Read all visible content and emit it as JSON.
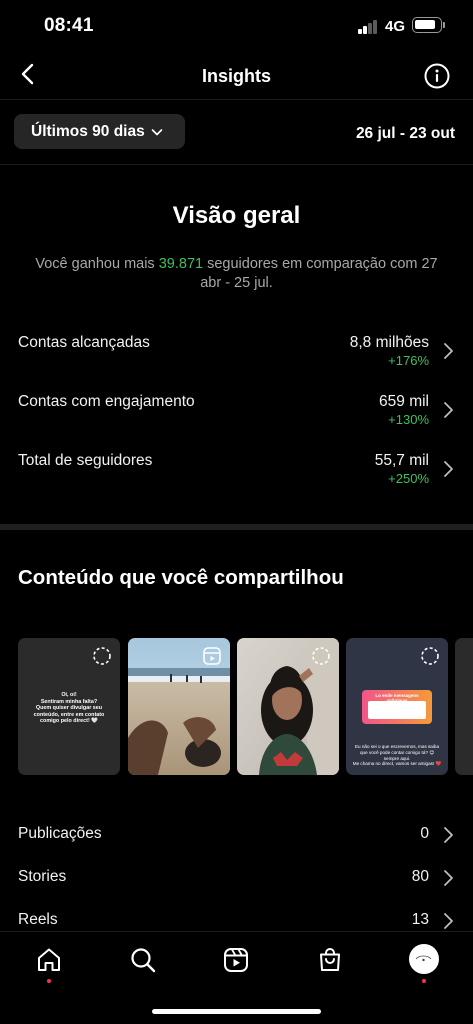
{
  "status_bar": {
    "time": "08:41",
    "network": "4G"
  },
  "nav": {
    "title": "Insights"
  },
  "filter": {
    "range_label": "Últimos 90 dias",
    "date_range": "26 jul - 23 out"
  },
  "overview": {
    "title": "Visão geral",
    "summary_prefix": "Você ganhou mais ",
    "summary_highlight": "39.871",
    "summary_suffix": " seguidores em comparação com 27 abr - 25 jul."
  },
  "metrics": [
    {
      "label": "Contas alcançadas",
      "value": "8,8 milhões",
      "change": "+176%"
    },
    {
      "label": "Contas com engajamento",
      "value": "659 mil",
      "change": "+130%"
    },
    {
      "label": "Total de seguidores",
      "value": "55,7 mil",
      "change": "+250%"
    }
  ],
  "content": {
    "title": "Conteúdo que você compartilhou",
    "story1_text": "Oi, oi!\nSentiram minha falta?\nQuem quiser divulgar seu conteúdo, entre em contato comigo pelo direct! 🤍",
    "story4_card_title": "Lo ende mensagens anônimas",
    "story4_text": "Eu não sei o que escrevemos, mas saiba que você pode contar comigo tá? 😊 sempre aqui.\nMe chama no direct, vamos ser amigas! ❤️"
  },
  "list": [
    {
      "label": "Publicações",
      "value": "0"
    },
    {
      "label": "Stories",
      "value": "80"
    },
    {
      "label": "Reels",
      "value": "13"
    }
  ],
  "colors": {
    "background": "#000000",
    "positive": "#3ec05a",
    "secondary_text": "#a8a8a8",
    "chip": "#262626",
    "notification": "#ff3040"
  },
  "icons": {
    "back": "back-icon",
    "info": "info-icon",
    "dropdown": "chevron-down-icon",
    "row": "chevron-right-icon",
    "home": "home-icon",
    "search": "search-icon",
    "reels": "reels-icon",
    "shop": "shop-icon"
  }
}
